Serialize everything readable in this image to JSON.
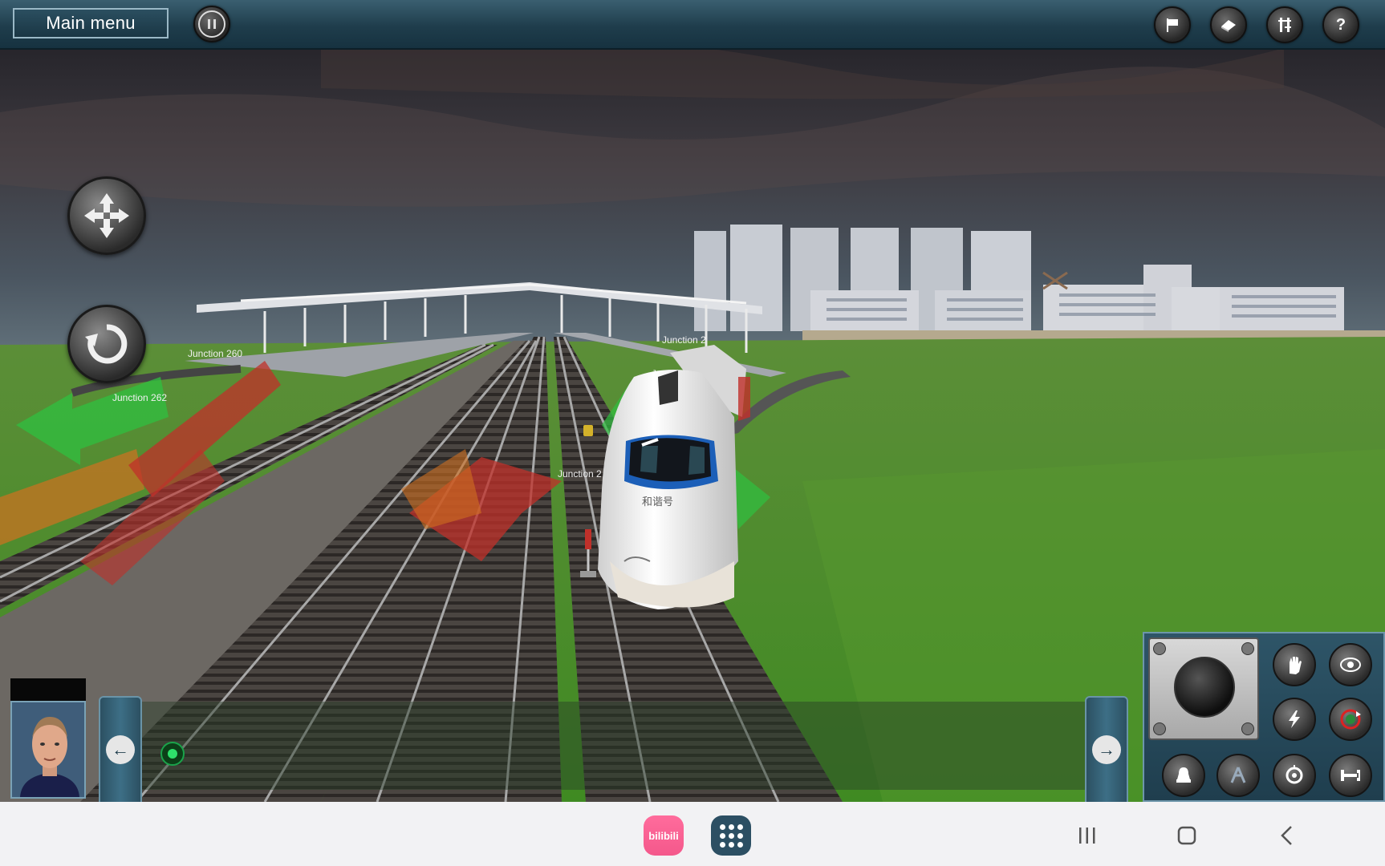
{
  "top_bar": {
    "main_menu_label": "Main menu"
  },
  "junction_labels": [
    "Junction 260",
    "Junction 262",
    "Junction 2",
    "Junction 2",
    "Junct"
  ],
  "train": {
    "name_plate": "和谐号"
  },
  "nav": {
    "bilibili_label": "bilibili"
  },
  "colors": {
    "ui_panel": "#1f3d4c",
    "sky": "#2b2b32",
    "grass": "#4c8a2a",
    "switch_red": "#c0302a",
    "switch_green": "#2fc040",
    "switch_orange": "#d07020",
    "bilibili_pink": "#f4588b"
  },
  "icons": {
    "top_bar": [
      "pause-icon",
      "flag-icon",
      "eraser-icon",
      "track-tools-icon",
      "help-icon"
    ],
    "camera": [
      "move-camera-icon",
      "rotate-camera-icon"
    ],
    "control_panel": [
      "stop-hand-icon",
      "camera-view-icon",
      "power-icon",
      "reverse-icon",
      "horn-icon",
      "pantograph-icon",
      "headlight-icon",
      "coupler-icon"
    ]
  }
}
